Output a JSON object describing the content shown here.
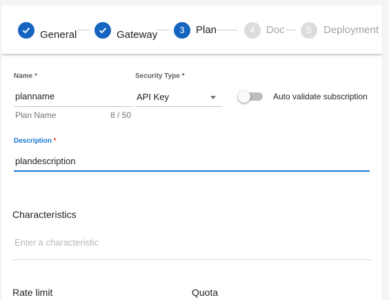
{
  "stepper": {
    "steps": [
      {
        "label": "General",
        "number": "1",
        "state": "completed",
        "icon": "check-icon"
      },
      {
        "label": "Gateway",
        "number": "2",
        "state": "completed",
        "icon": "check-icon"
      },
      {
        "label": "Plan",
        "number": "3",
        "state": "active"
      },
      {
        "label": "Doc",
        "number": "4",
        "state": "disabled"
      },
      {
        "label": "Deployment",
        "number": "5",
        "state": "disabled"
      }
    ]
  },
  "form": {
    "name": {
      "label": "Name",
      "required_mark": "*",
      "value": "planname",
      "hint": "Plan Name",
      "counter": "8 / 50"
    },
    "security_type": {
      "label": "Security Type",
      "required_mark": "*",
      "value": "API Key"
    },
    "auto_validate": {
      "label": "Auto validate subscription",
      "enabled": false
    },
    "description": {
      "label": "Description",
      "required_mark": "*",
      "value": "plandescription"
    },
    "characteristics": {
      "title": "Characteristics",
      "placeholder": "Enter a characteristic"
    },
    "rate_limit": {
      "title": "Rate limit"
    },
    "quota": {
      "title": "Quota"
    }
  },
  "colors": {
    "primary": "#1565c0",
    "focus": "#1976d2",
    "required_focus": "#e53935",
    "disabled_step": "#dcdcdc"
  }
}
